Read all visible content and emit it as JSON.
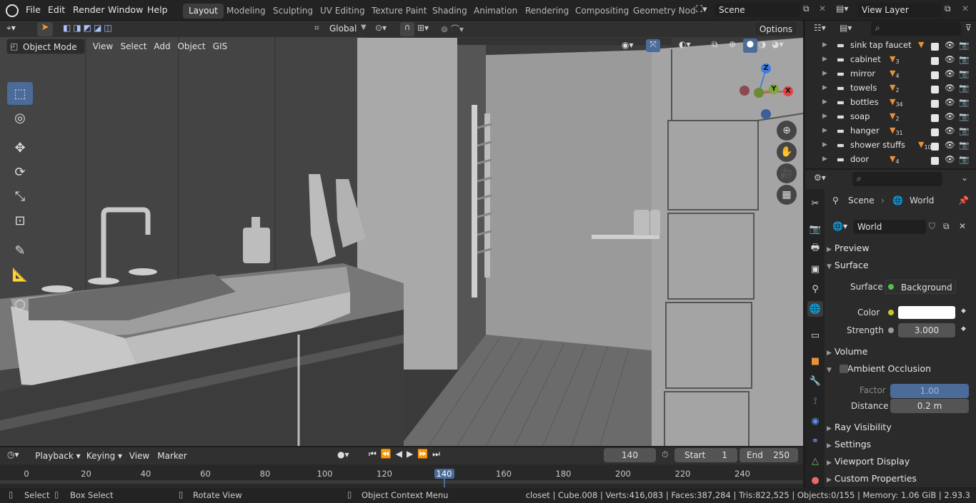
{
  "topbar": {
    "menus": [
      "File",
      "Edit",
      "Render",
      "Window",
      "Help"
    ],
    "workspaces": [
      "Layout",
      "Modeling",
      "Sculpting",
      "UV Editing",
      "Texture Paint",
      "Shading",
      "Animation",
      "Rendering",
      "Compositing",
      "Geometry Nod"
    ],
    "active_workspace": "Layout",
    "scene": "Scene",
    "view_layer": "View Layer"
  },
  "viewport_header": {
    "orientation": "Global",
    "options": "Options",
    "mode": "Object Mode",
    "menus": [
      "View",
      "Select",
      "Add",
      "Object",
      "GIS"
    ]
  },
  "gizmo": {
    "z": "Z",
    "y": "Y",
    "x": "X"
  },
  "outliner": {
    "items": [
      {
        "name": "sink tap faucet",
        "count": ""
      },
      {
        "name": "cabinet",
        "count": "3"
      },
      {
        "name": "mirror",
        "count": "4"
      },
      {
        "name": "towels",
        "count": "2"
      },
      {
        "name": "bottles",
        "count": "34"
      },
      {
        "name": "soap",
        "count": "2"
      },
      {
        "name": "hanger",
        "count": "31"
      },
      {
        "name": "shower stuffs",
        "count": "10"
      },
      {
        "name": "door",
        "count": "4"
      }
    ]
  },
  "properties": {
    "breadcrumb_scene": "Scene",
    "breadcrumb_world": "World",
    "world_name": "World",
    "panels": {
      "preview": "Preview",
      "surface": "Surface",
      "volume": "Volume",
      "ao": "Ambient Occlusion",
      "ray_visibility": "Ray Visibility",
      "settings": "Settings",
      "viewport_display": "Viewport Display",
      "custom_properties": "Custom Properties"
    },
    "surface_label": "Surface",
    "surface_value": "Background",
    "color_label": "Color",
    "color_value": "#ffffff",
    "strength_label": "Strength",
    "strength_value": "3.000",
    "factor_label": "Factor",
    "factor_value": "1.00",
    "distance_label": "Distance",
    "distance_value": "0.2 m"
  },
  "timeline": {
    "menus": [
      "Playback",
      "Keying",
      "View",
      "Marker"
    ],
    "current_frame": "140",
    "start_label": "Start",
    "start": "1",
    "end_label": "End",
    "end": "250",
    "ticks": [
      "0",
      "20",
      "40",
      "60",
      "80",
      "100",
      "120",
      "140",
      "160",
      "180",
      "200",
      "220",
      "240"
    ],
    "playhead": "140"
  },
  "statusbar": {
    "select": "Select",
    "box_select": "Box Select",
    "rotate_view": "Rotate View",
    "context_menu": "Object Context Menu",
    "stats": "closet | Cube.008 | Verts:416,083 | Faces:387,284 | Tris:822,525 | Objects:0/155 | Memory: 1.06 GiB | 2.93.3"
  }
}
